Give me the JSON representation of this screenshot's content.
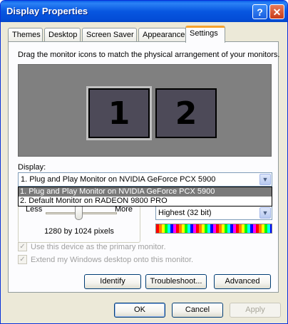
{
  "window": {
    "title": "Display Properties"
  },
  "titlebar": {
    "help_glyph": "?",
    "close_glyph": "✕"
  },
  "tabs": [
    {
      "label": "Themes",
      "active": false
    },
    {
      "label": "Desktop",
      "active": false
    },
    {
      "label": "Screen Saver",
      "active": false
    },
    {
      "label": "Appearance",
      "active": false
    },
    {
      "label": "Settings",
      "active": true
    }
  ],
  "settings": {
    "instruction": "Drag the monitor icons to match the physical arrangement of your monitors.",
    "monitors": [
      "1",
      "2"
    ],
    "display_label": "Display:",
    "display_value": "1. Plug and Play Monitor on NVIDIA GeForce PCX 5900",
    "dropdown_options": [
      "1. Plug and Play Monitor on NVIDIA GeForce PCX 5900",
      "2. Default Monitor on RADEON 9800 PRO"
    ],
    "resolution": {
      "less": "Less",
      "more": "More",
      "value": "1280 by 1024 pixels"
    },
    "color_quality": {
      "value": "Highest (32 bit)"
    },
    "primary_checkbox": "Use this device as the primary monitor.",
    "extend_checkbox": "Extend my Windows desktop onto this monitor.",
    "buttons": {
      "identify": "Identify",
      "troubleshoot": "Troubleshoot...",
      "advanced": "Advanced"
    }
  },
  "footer": {
    "ok": "OK",
    "cancel": "Cancel",
    "apply": "Apply"
  },
  "colors": {
    "titlebar": "#0756e0",
    "face": "#ece9d8",
    "monitor_bg": "#808080",
    "selection": "#7a7a7a"
  }
}
